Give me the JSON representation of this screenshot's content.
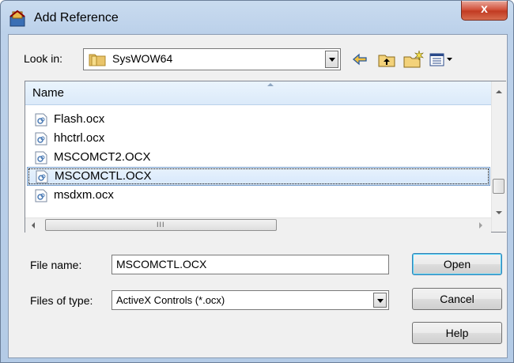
{
  "window": {
    "title": "Add Reference",
    "close_label": "x"
  },
  "lookin": {
    "label": "Look in:",
    "value": "SysWOW64"
  },
  "toolbar": {
    "icons": [
      "back-arrow-icon",
      "up-folder-icon",
      "new-folder-icon",
      "view-menu-icon"
    ]
  },
  "filelist": {
    "column_header": "Name",
    "files": [
      {
        "name": "Flash.ocx",
        "selected": false
      },
      {
        "name": "hhctrl.ocx",
        "selected": false
      },
      {
        "name": "MSCOMCT2.OCX",
        "selected": false
      },
      {
        "name": "MSCOMCTL.OCX",
        "selected": true
      },
      {
        "name": "msdxm.ocx",
        "selected": false
      }
    ],
    "hscroll_grip": "III"
  },
  "form": {
    "filename_label": "File name:",
    "filename_value": "MSCOMCTL.OCX",
    "filetype_label": "Files of type:",
    "filetype_value": "ActiveX Controls (*.ocx)"
  },
  "buttons": {
    "open": "Open",
    "cancel": "Cancel",
    "help": "Help"
  },
  "colors": {
    "selection": "#d7e8fb",
    "accent": "#3c7fb1",
    "close": "#c23b22"
  }
}
